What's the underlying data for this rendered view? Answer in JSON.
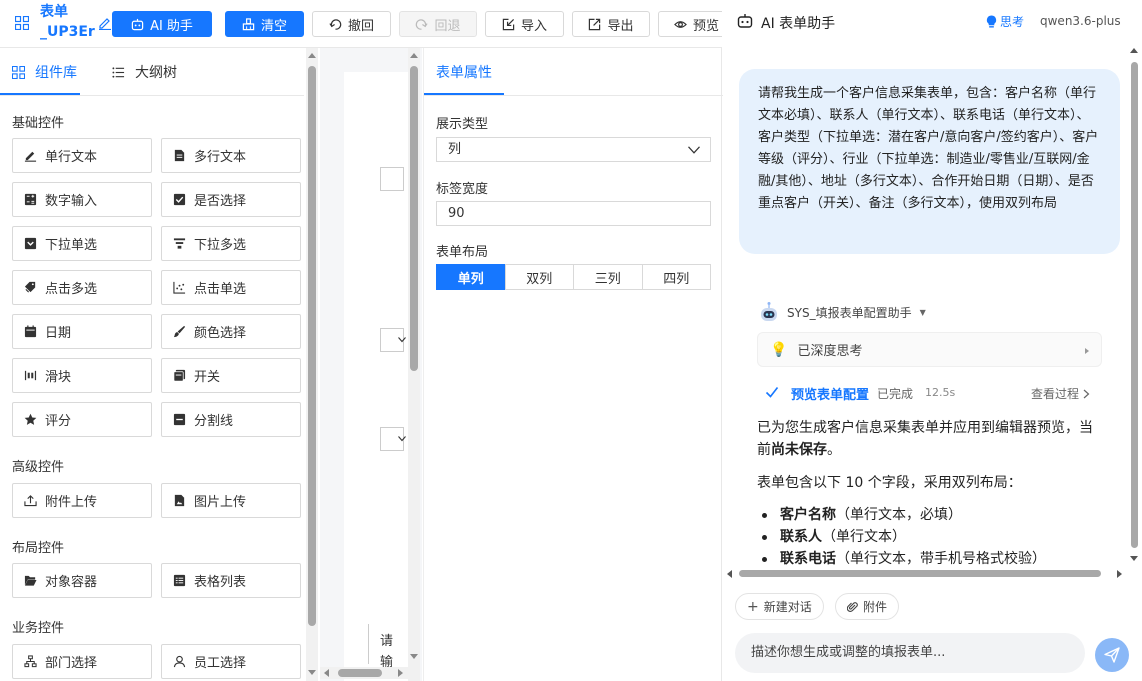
{
  "toolbar": {
    "form_title": "表单_UP3Er",
    "buttons": {
      "ai_helper": "AI 助手",
      "clear": "清空",
      "undo": "撤回",
      "redo": "回退",
      "import": "导入",
      "export": "导出",
      "preview": "预览"
    },
    "accent": "#1677ff"
  },
  "palette": {
    "tabs": {
      "components": "组件库",
      "outline": "大纲树"
    },
    "groups": {
      "basic": {
        "title": "基础控件",
        "items": [
          "单行文本",
          "多行文本",
          "数字输入",
          "是否选择",
          "下拉单选",
          "下拉多选",
          "点击多选",
          "点击单选",
          "日期",
          "颜色选择",
          "滑块",
          "开关",
          "评分",
          "分割线"
        ]
      },
      "advanced": {
        "title": "高级控件",
        "items": [
          "附件上传",
          "图片上传"
        ]
      },
      "layout": {
        "title": "布局控件",
        "items": [
          "对象容器",
          "表格列表"
        ]
      },
      "business": {
        "title": "业务控件",
        "items": [
          "部门选择",
          "员工选择"
        ]
      }
    }
  },
  "canvas": {
    "partial_text_1": "请",
    "partial_text_2": "输"
  },
  "properties": {
    "tab": "表单属性",
    "display_type": {
      "label": "展示类型",
      "value": "列"
    },
    "label_width": {
      "label": "标签宽度",
      "value": "90"
    },
    "layout": {
      "label": "表单布局",
      "options": [
        "单列",
        "双列",
        "三列",
        "四列"
      ],
      "selected": "单列"
    }
  },
  "ai": {
    "title": "AI 表单助手",
    "think_label": "思考",
    "model": "qwen3.6-plus",
    "user_message": "请帮我生成一个客户信息采集表单，包含：客户名称（单行文本必填）、联系人（单行文本）、联系电话（单行文本）、客户类型（下拉单选：潜在客户/意向客户/签约客户）、客户等级（评分）、行业（下拉单选：制造业/零售业/互联网/金融/其他）、地址（多行文本）、合作开始日期（日期）、是否重点客户（开关）、备注（多行文本），使用双列布局",
    "bot_name": "SYS_填报表单配置助手",
    "thinking_label": "已深度思考",
    "step": {
      "name": "预览表单配置",
      "status": "已完成",
      "time": "12.5s",
      "view": "查看过程"
    },
    "reply": {
      "para1_prefix": "已为您生成客户信息采集表单并应用到编辑器预览，当前",
      "para1_bold": "尚未保存",
      "para1_suffix": "。",
      "para2": "表单包含以下 10 个字段，采用双列布局：",
      "fields": [
        {
          "name": "客户名称",
          "desc": "（单行文本，必填）"
        },
        {
          "name": "联系人",
          "desc": "（单行文本）"
        },
        {
          "name": "联系电话",
          "desc": "（单行文本，带手机号格式校验）"
        }
      ]
    },
    "chips": {
      "new_chat": "新建对话",
      "attach": "附件"
    },
    "input_placeholder": "描述你想生成或调整的填报表单..."
  }
}
